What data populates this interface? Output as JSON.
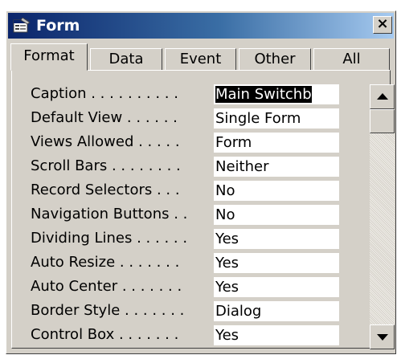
{
  "window": {
    "title": "Form",
    "close_label": "×"
  },
  "tabs": [
    {
      "label": "Format",
      "active": true
    },
    {
      "label": "Data",
      "active": false
    },
    {
      "label": "Event",
      "active": false
    },
    {
      "label": "Other",
      "active": false
    },
    {
      "label": "All",
      "active": false
    }
  ],
  "properties": [
    {
      "label": "Caption . . . . . . . . . .",
      "value": "Main Switchb",
      "selected": true
    },
    {
      "label": "Default View . . . . . .",
      "value": "Single Form"
    },
    {
      "label": "Views Allowed . . . . .",
      "value": "Form"
    },
    {
      "label": "Scroll Bars . . . . . . . .",
      "value": "Neither"
    },
    {
      "label": "Record Selectors . . .",
      "value": "No"
    },
    {
      "label": "Navigation Buttons . .",
      "value": "No"
    },
    {
      "label": "Dividing Lines . . . . . .",
      "value": "Yes"
    },
    {
      "label": "Auto Resize . . . . . . .",
      "value": "Yes"
    },
    {
      "label": "Auto Center . . . . . . .",
      "value": "Yes"
    },
    {
      "label": "Border Style . . . . . . .",
      "value": "Dialog"
    },
    {
      "label": "Control Box . . . . . . .",
      "value": "Yes"
    }
  ],
  "icons": {
    "title": "form-icon",
    "scroll_up": "scroll-up-arrow-icon",
    "scroll_down": "scroll-down-arrow-icon"
  },
  "colors": {
    "title_bar_start": "#0a246a",
    "title_bar_end": "#a6caf0",
    "face": "#d4d0c8",
    "selection": "#000000"
  }
}
